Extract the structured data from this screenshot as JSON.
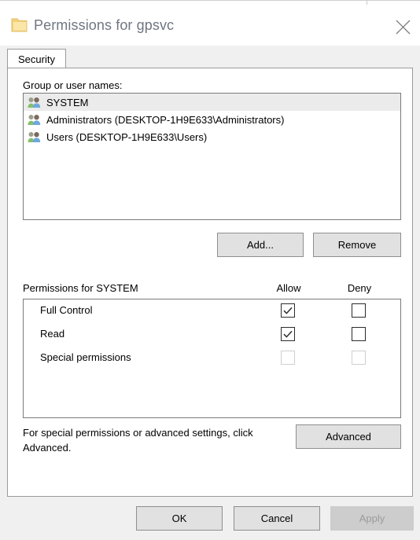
{
  "window": {
    "title": "Permissions for gpsvc",
    "folder_icon": "folder-icon",
    "close_icon": "close-icon"
  },
  "tabs": [
    {
      "label": "Security",
      "active": true
    }
  ],
  "group_section": {
    "label": "Group or user names:",
    "items": [
      {
        "name": "SYSTEM",
        "icon": "group-users-icon",
        "selected": true
      },
      {
        "name": "Administrators (DESKTOP-1H9E633\\Administrators)",
        "icon": "group-users-icon",
        "selected": false
      },
      {
        "name": "Users (DESKTOP-1H9E633\\Users)",
        "icon": "group-users-icon",
        "selected": false
      }
    ],
    "add_label": "Add...",
    "remove_label": "Remove"
  },
  "permissions_section": {
    "label": "Permissions for SYSTEM",
    "allow_label": "Allow",
    "deny_label": "Deny",
    "rows": [
      {
        "name": "Full Control",
        "allow": true,
        "deny": false,
        "disabled": false
      },
      {
        "name": "Read",
        "allow": true,
        "deny": false,
        "disabled": false
      },
      {
        "name": "Special permissions",
        "allow": false,
        "deny": false,
        "disabled": true
      }
    ]
  },
  "advanced_section": {
    "text": "For special permissions or advanced settings, click Advanced.",
    "button_label": "Advanced"
  },
  "footer": {
    "ok_label": "OK",
    "cancel_label": "Cancel",
    "apply_label": "Apply",
    "apply_enabled": false
  },
  "colors": {
    "window_bg": "#f0f0f0",
    "panel_bg": "#ffffff",
    "button_face": "#e1e1e1",
    "button_disabled": "#cdcdcd",
    "selection": "#ebebeb",
    "title_text": "#6f7681",
    "border": "#7a7a7a",
    "folder": "#f7d98a"
  }
}
